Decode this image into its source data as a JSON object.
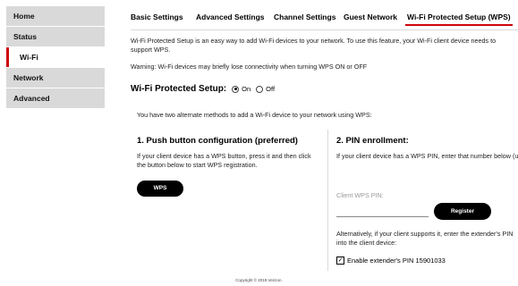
{
  "sidebar": {
    "items": [
      {
        "label": "Home"
      },
      {
        "label": "Status"
      },
      {
        "label": "Wi-Fi"
      },
      {
        "label": "Network"
      },
      {
        "label": "Advanced"
      }
    ]
  },
  "tabs": [
    {
      "label": "Basic Settings"
    },
    {
      "label": "Advanced Settings"
    },
    {
      "label": "Channel Settings"
    },
    {
      "label": "Guest Network"
    },
    {
      "label": "Wi-Fi Protected Setup (WPS)"
    }
  ],
  "colors": {
    "accent": "#cd040b",
    "sidebar_bg": "#d9d9d9"
  },
  "intro": "Wi-Fi Protected Setup is an easy way to add Wi-Fi devices to your network. To use this feature, your Wi-Fi client device needs to support WPS.",
  "warning": "Warning: Wi-Fi devices may briefly lose connectivity when turning WPS ON or OFF",
  "wps": {
    "label": "Wi-Fi Protected Setup:",
    "on_label": "On",
    "off_label": "Off",
    "selected": "On"
  },
  "methods_text": "You have two alternate methods to add a Wi-Fi device to your network using WPS:",
  "push": {
    "title": "1. Push button configuration (preferred)",
    "desc": "If your client device has a WPS button, press it and then click the button below to start WPS registration.",
    "button": "WPS"
  },
  "pin": {
    "title": "2. PIN enrollment:",
    "desc": "If your client device has a WPS PIN, enter that number below (usually found on a sticker on the back of the device) and click \"Register\":",
    "input_label": "Client WPS PIN:",
    "input_value": "",
    "register_button": "Register",
    "alt_text": "Alternatively, if your client supports it, enter the extender's PIN into the client device:",
    "checkbox_label": "Enable extender's PIN 15901033",
    "checkbox_checked": true
  },
  "footer": {
    "copyright": "Copyright © 2019 Verizon."
  }
}
